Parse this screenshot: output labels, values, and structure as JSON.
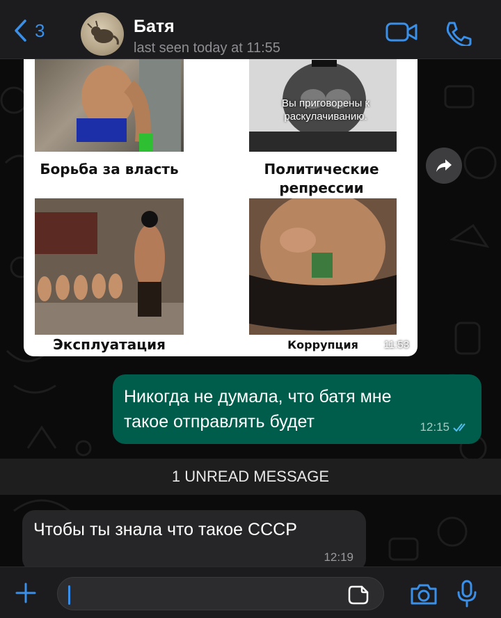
{
  "header": {
    "back_count": "3",
    "contact_name": "Батя",
    "status": "last seen today at 11:55"
  },
  "image_message": {
    "captions": [
      "Борьба за власть",
      "Политические\nрепрессии",
      "Эксплуатация",
      "Коррупция"
    ],
    "overlay_text": "Вы приговорены к\nраскулачиванию.",
    "time": "11:53"
  },
  "outgoing_message": {
    "text": "Никогда не думала, что батя мне такое отправлять будет",
    "time": "12:15"
  },
  "unread_banner": "1 UNREAD MESSAGE",
  "incoming_message": {
    "text": "Чтобы ты знала что такое СССР",
    "time": "12:19"
  },
  "input": {
    "value": ""
  },
  "colors": {
    "accent": "#3a8fe8",
    "outgoing_bubble": "#005c4b",
    "incoming_bubble": "#262628",
    "background": "#0b0b0b"
  },
  "icons": {
    "back": "chevron-left-icon",
    "video": "video-camera-icon",
    "call": "phone-icon",
    "forward": "forward-arrow-icon",
    "read": "double-check-icon",
    "attach": "plus-icon",
    "sticker": "sticker-icon",
    "camera": "camera-icon",
    "mic": "microphone-icon"
  }
}
